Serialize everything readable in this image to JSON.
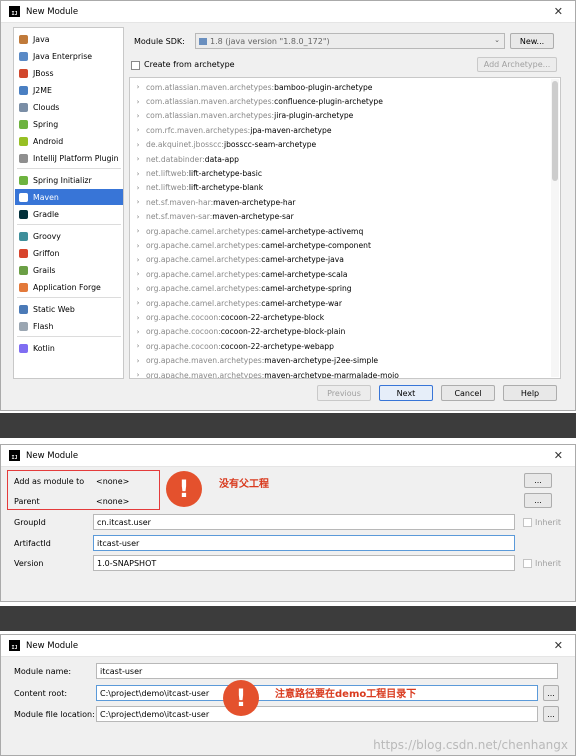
{
  "dialog1": {
    "title": "New Module",
    "sdk_label": "Module SDK:",
    "sdk_value": "1.8 (java version \"1.8.0_172\")",
    "new_btn": "New...",
    "create_from_archetype": "Create from archetype",
    "add_archetype_btn": "Add Archetype...",
    "sidebar": [
      {
        "label": "Java",
        "color": "#c07a3a"
      },
      {
        "label": "Java Enterprise",
        "color": "#5a8ac6"
      },
      {
        "label": "JBoss",
        "color": "#d1472c"
      },
      {
        "label": "J2ME",
        "color": "#4a7fc2"
      },
      {
        "label": "Clouds",
        "color": "#7a8ea6"
      },
      {
        "label": "Spring",
        "color": "#6db33f"
      },
      {
        "label": "Android",
        "color": "#97c024"
      },
      {
        "label": "IntelliJ Platform Plugin",
        "color": "#8f8f8f"
      },
      {
        "label": "Spring Initializr",
        "color": "#6db33f"
      },
      {
        "label": "Maven",
        "color": "#ffffff"
      },
      {
        "label": "Gradle",
        "color": "#02303a"
      },
      {
        "label": "Groovy",
        "color": "#3e8f9b"
      },
      {
        "label": "Griffon",
        "color": "#d8442c"
      },
      {
        "label": "Grails",
        "color": "#6b9f45"
      },
      {
        "label": "Application Forge",
        "color": "#e3793a"
      },
      {
        "label": "Static Web",
        "color": "#4b7ab7"
      },
      {
        "label": "Flash",
        "color": "#9aa6b2"
      },
      {
        "label": "Kotlin",
        "color": "#7f6df2"
      }
    ],
    "archetypes": [
      {
        "group": "com.atlassian.maven.archetypes:",
        "artifact": "bamboo-plugin-archetype"
      },
      {
        "group": "com.atlassian.maven.archetypes:",
        "artifact": "confluence-plugin-archetype"
      },
      {
        "group": "com.atlassian.maven.archetypes:",
        "artifact": "jira-plugin-archetype"
      },
      {
        "group": "com.rfc.maven.archetypes:",
        "artifact": "jpa-maven-archetype"
      },
      {
        "group": "de.akquinet.jbosscc:",
        "artifact": "jbosscc-seam-archetype"
      },
      {
        "group": "net.databinder:",
        "artifact": "data-app"
      },
      {
        "group": "net.liftweb:",
        "artifact": "lift-archetype-basic"
      },
      {
        "group": "net.liftweb:",
        "artifact": "lift-archetype-blank"
      },
      {
        "group": "net.sf.maven-har:",
        "artifact": "maven-archetype-har"
      },
      {
        "group": "net.sf.maven-sar:",
        "artifact": "maven-archetype-sar"
      },
      {
        "group": "org.apache.camel.archetypes:",
        "artifact": "camel-archetype-activemq"
      },
      {
        "group": "org.apache.camel.archetypes:",
        "artifact": "camel-archetype-component"
      },
      {
        "group": "org.apache.camel.archetypes:",
        "artifact": "camel-archetype-java"
      },
      {
        "group": "org.apache.camel.archetypes:",
        "artifact": "camel-archetype-scala"
      },
      {
        "group": "org.apache.camel.archetypes:",
        "artifact": "camel-archetype-spring"
      },
      {
        "group": "org.apache.camel.archetypes:",
        "artifact": "camel-archetype-war"
      },
      {
        "group": "org.apache.cocoon:",
        "artifact": "cocoon-22-archetype-block"
      },
      {
        "group": "org.apache.cocoon:",
        "artifact": "cocoon-22-archetype-block-plain"
      },
      {
        "group": "org.apache.cocoon:",
        "artifact": "cocoon-22-archetype-webapp"
      },
      {
        "group": "org.apache.maven.archetypes:",
        "artifact": "maven-archetype-j2ee-simple"
      },
      {
        "group": "org.apache.maven.archetypes:",
        "artifact": "maven-archetype-marmalade-mojo"
      }
    ],
    "buttons": {
      "previous": "Previous",
      "next": "Next",
      "cancel": "Cancel",
      "help": "Help"
    }
  },
  "dialog2": {
    "title": "New Module",
    "add_as_module_label": "Add as module to",
    "add_as_module_value": "<none>",
    "parent_label": "Parent",
    "parent_value": "<none>",
    "groupid_label": "GroupId",
    "groupid_value": "cn.itcast.user",
    "artifactid_label": "ArtifactId",
    "artifactid_value": "itcast-user",
    "version_label": "Version",
    "version_value": "1.0-SNAPSHOT",
    "inherit": "Inherit",
    "browse": "...",
    "annotation": "没有父工程",
    "warn_glyph": "!"
  },
  "dialog3": {
    "title": "New Module",
    "module_name_label": "Module name:",
    "module_name_value": "itcast-user",
    "content_root_label": "Content root:",
    "content_root_value": "C:\\project\\demo\\itcast-user",
    "module_file_label": "Module file location:",
    "module_file_value": "C:\\project\\demo\\itcast-user",
    "browse": "...",
    "annotation": "注意路径要在demo工程目录下",
    "warn_glyph": "!"
  },
  "watermark": "https://blog.csdn.net/chenhangx",
  "colors": {
    "selection": "#3875d7",
    "warn": "#e4512d",
    "annotation": "#d93a1e",
    "redbox": "#e43b3b"
  }
}
